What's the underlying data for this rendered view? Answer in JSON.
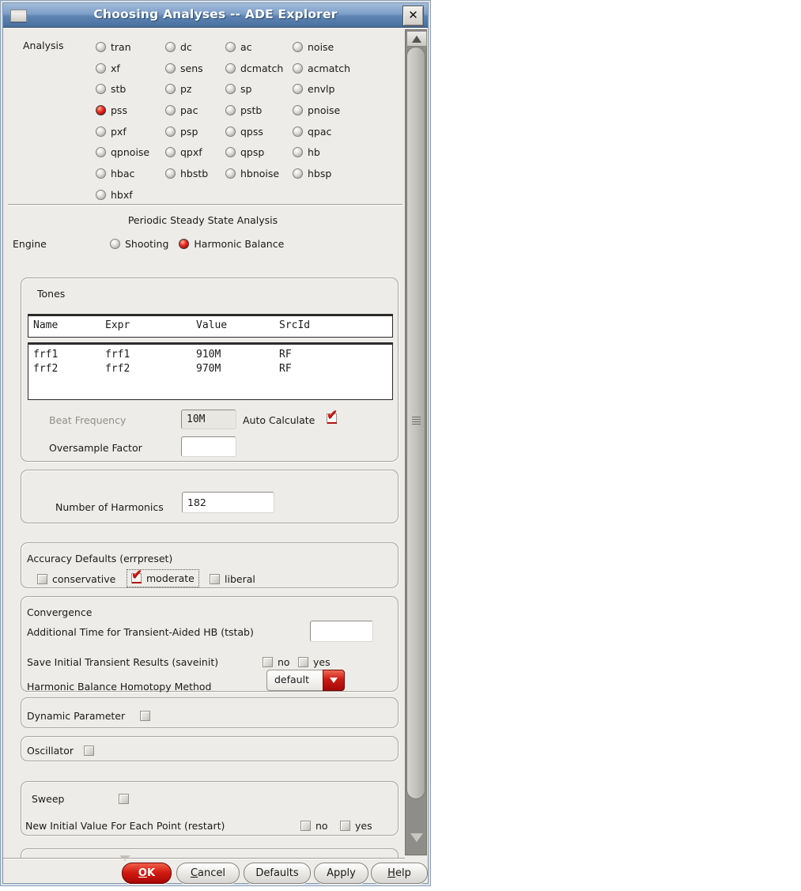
{
  "window": {
    "title": "Choosing Analyses -- ADE Explorer"
  },
  "icons": {
    "close": "✕"
  },
  "analysis": {
    "label": "Analysis",
    "options": [
      {
        "label": "tran",
        "checked": false
      },
      {
        "label": "dc",
        "checked": false
      },
      {
        "label": "ac",
        "checked": false
      },
      {
        "label": "noise",
        "checked": false
      },
      {
        "label": "xf",
        "checked": false
      },
      {
        "label": "sens",
        "checked": false
      },
      {
        "label": "dcmatch",
        "checked": false
      },
      {
        "label": "acmatch",
        "checked": false
      },
      {
        "label": "stb",
        "checked": false
      },
      {
        "label": "pz",
        "checked": false
      },
      {
        "label": "sp",
        "checked": false
      },
      {
        "label": "envlp",
        "checked": false
      },
      {
        "label": "pss",
        "checked": true
      },
      {
        "label": "pac",
        "checked": false
      },
      {
        "label": "pstb",
        "checked": false
      },
      {
        "label": "pnoise",
        "checked": false
      },
      {
        "label": "pxf",
        "checked": false
      },
      {
        "label": "psp",
        "checked": false
      },
      {
        "label": "qpss",
        "checked": false
      },
      {
        "label": "qpac",
        "checked": false
      },
      {
        "label": "qpnoise",
        "checked": false
      },
      {
        "label": "qpxf",
        "checked": false
      },
      {
        "label": "qpsp",
        "checked": false
      },
      {
        "label": "hb",
        "checked": false
      },
      {
        "label": "hbac",
        "checked": false
      },
      {
        "label": "hbstb",
        "checked": false
      },
      {
        "label": "hbnoise",
        "checked": false
      },
      {
        "label": "hbsp",
        "checked": false
      },
      {
        "label": "hbxf",
        "checked": false
      }
    ]
  },
  "engine": {
    "heading": "Periodic Steady State Analysis",
    "label": "Engine",
    "options": [
      {
        "label": "Shooting",
        "checked": false
      },
      {
        "label": "Harmonic Balance",
        "checked": true
      }
    ]
  },
  "tones": {
    "title": "Tones",
    "columns": [
      "Name",
      "Expr",
      "Value",
      "SrcId"
    ],
    "rows": [
      [
        "frf1",
        "frf1",
        "910M",
        "RF"
      ],
      [
        "frf2",
        "frf2",
        "970M",
        "RF"
      ]
    ],
    "beat_frequency_label": "Beat Frequency",
    "beat_frequency_value": "10M",
    "auto_calculate_label": "Auto Calculate",
    "auto_calculate_checked": true,
    "oversample_label": "Oversample Factor",
    "oversample_value": ""
  },
  "harmonics": {
    "label": "Number of Harmonics",
    "value": "182"
  },
  "accuracy": {
    "title": "Accuracy Defaults (errpreset)",
    "options": [
      {
        "label": "conservative",
        "checked": false
      },
      {
        "label": "moderate",
        "checked": true
      },
      {
        "label": "liberal",
        "checked": false
      }
    ]
  },
  "convergence": {
    "title": "Convergence",
    "tstab_label": "Additional Time for Transient-Aided HB (tstab)",
    "tstab_value": "",
    "saveinit_label": "Save Initial Transient Results (saveinit)",
    "saveinit_no_label": "no",
    "saveinit_no_checked": false,
    "saveinit_yes_label": "yes",
    "saveinit_yes_checked": false,
    "homotopy_label": "Harmonic Balance Homotopy Method",
    "homotopy_value": "default"
  },
  "dynamic_parameter": {
    "label": "Dynamic Parameter",
    "checked": false
  },
  "oscillator": {
    "label": "Oscillator",
    "checked": false
  },
  "sweep": {
    "label": "Sweep",
    "checked": false,
    "restart_label": "New Initial Value For Each Point (restart)",
    "restart_no_label": "no",
    "restart_no_checked": false,
    "restart_yes_label": "yes",
    "restart_yes_checked": false
  },
  "buttons": {
    "ok": {
      "u": "O",
      "rest": "K"
    },
    "cancel": {
      "u": "C",
      "rest": "ancel"
    },
    "defaults": {
      "u": "",
      "rest": "Defaults"
    },
    "apply": {
      "u": "",
      "rest": "Apply"
    },
    "help": {
      "u": "H",
      "rest": "elp"
    }
  },
  "colors": {
    "accent_red": "#cc1510",
    "titlebar_blue": "#5d84b3"
  }
}
